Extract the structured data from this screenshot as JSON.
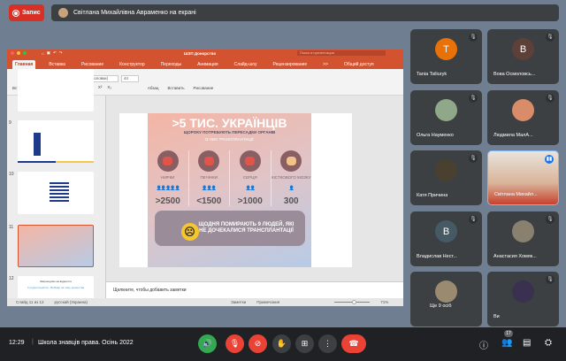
{
  "record": {
    "label": "Запис"
  },
  "presenter_banner": "Світлана Михайлівна Авраменко на екрані",
  "ppt": {
    "title": "ШЗП Донорство",
    "search_placeholder": "Поиск в презентации",
    "tabs": [
      "Главная",
      "Вставка",
      "Рисование",
      "Конструктор",
      "Переходы",
      "Анимация",
      "Слайд-шоу",
      "Рецензирование"
    ],
    "more": ">>",
    "share": "Общий доступ",
    "ribbon": {
      "paste": "Вставить",
      "slides": "Слайды",
      "font": "Calibri Light (Заголовки)",
      "size": "44",
      "format": [
        "Ж",
        "К",
        "Ч",
        "abc",
        "X²",
        "X₂"
      ],
      "paragraph": "Абзац",
      "insert": "Вставить",
      "drawing": "Рисование"
    },
    "thumbs": [
      {
        "n": "9"
      },
      {
        "n": "10"
      },
      {
        "n": "11"
      },
      {
        "n": "12",
        "title": "Запрошуємо на відкриття",
        "text": "4 грудня (неділя) - Вебінар на тему донорства"
      }
    ],
    "slide": {
      "title": ">5 ТИС. УКРАЇНЦІВ",
      "subtitle": "ЩОРОКУ ПОТРЕБУЮТЬ ПЕРЕСАДКИ ОРГАНІВ",
      "sub2": "ІЗ НИХ ТРАНСПЛАНТАЦІЇ:",
      "organs": [
        {
          "label": "НИРКИ",
          "value": ">2500"
        },
        {
          "label": "ПЕЧІНКИ",
          "value": "<1500"
        },
        {
          "label": "СЕРЦЯ",
          "value": ">1000"
        },
        {
          "label": "КІСТКОВОГО МОЗКУ",
          "value": "300"
        }
      ],
      "bottom": "ЩОДНЯ ПОМИРАЮТЬ 9 ЛЮДЕЙ, ЯКІ НЕ ДОЧЕКАЛИСЯ ТРАНСПЛАНТАЦІЇ"
    },
    "notes_placeholder": "Щелкните, чтобы добавить заметки",
    "status": {
      "slide": "Слайд 11 из 12",
      "lang": "русский (Украина)",
      "notes": "Заметки",
      "comments": "Примечания",
      "zoom": "71%",
      "zoom_percent": 71
    }
  },
  "participants": [
    {
      "name": "Tania Tsiliuryk",
      "initial": "T",
      "color": "#e8710a"
    },
    {
      "name": "Вова Осмоловсь...",
      "initial": "B",
      "color": "#5d4037"
    },
    {
      "name": "Ольга Науменко",
      "color": "#8fa88a"
    },
    {
      "name": "Людмила МалА...",
      "color": "#d98c6a"
    },
    {
      "name": "Катя Причина",
      "color": "#4a4030"
    },
    {
      "name": "Світлана Михайл...",
      "color": "#c8a080"
    },
    {
      "name": "Владислав Нест...",
      "initial": "B",
      "color": "#455a64"
    },
    {
      "name": "Анастасия Хомяк...",
      "color": "#8a8070"
    },
    {
      "name": "Ще 9 осіб",
      "color": "#9a8a70"
    },
    {
      "name": "Ви",
      "color": "#3a3050"
    }
  ],
  "bottom_bar": {
    "time": "12:29",
    "meeting": "Школа знавців права. Осінь 2022",
    "people_count": "17"
  }
}
